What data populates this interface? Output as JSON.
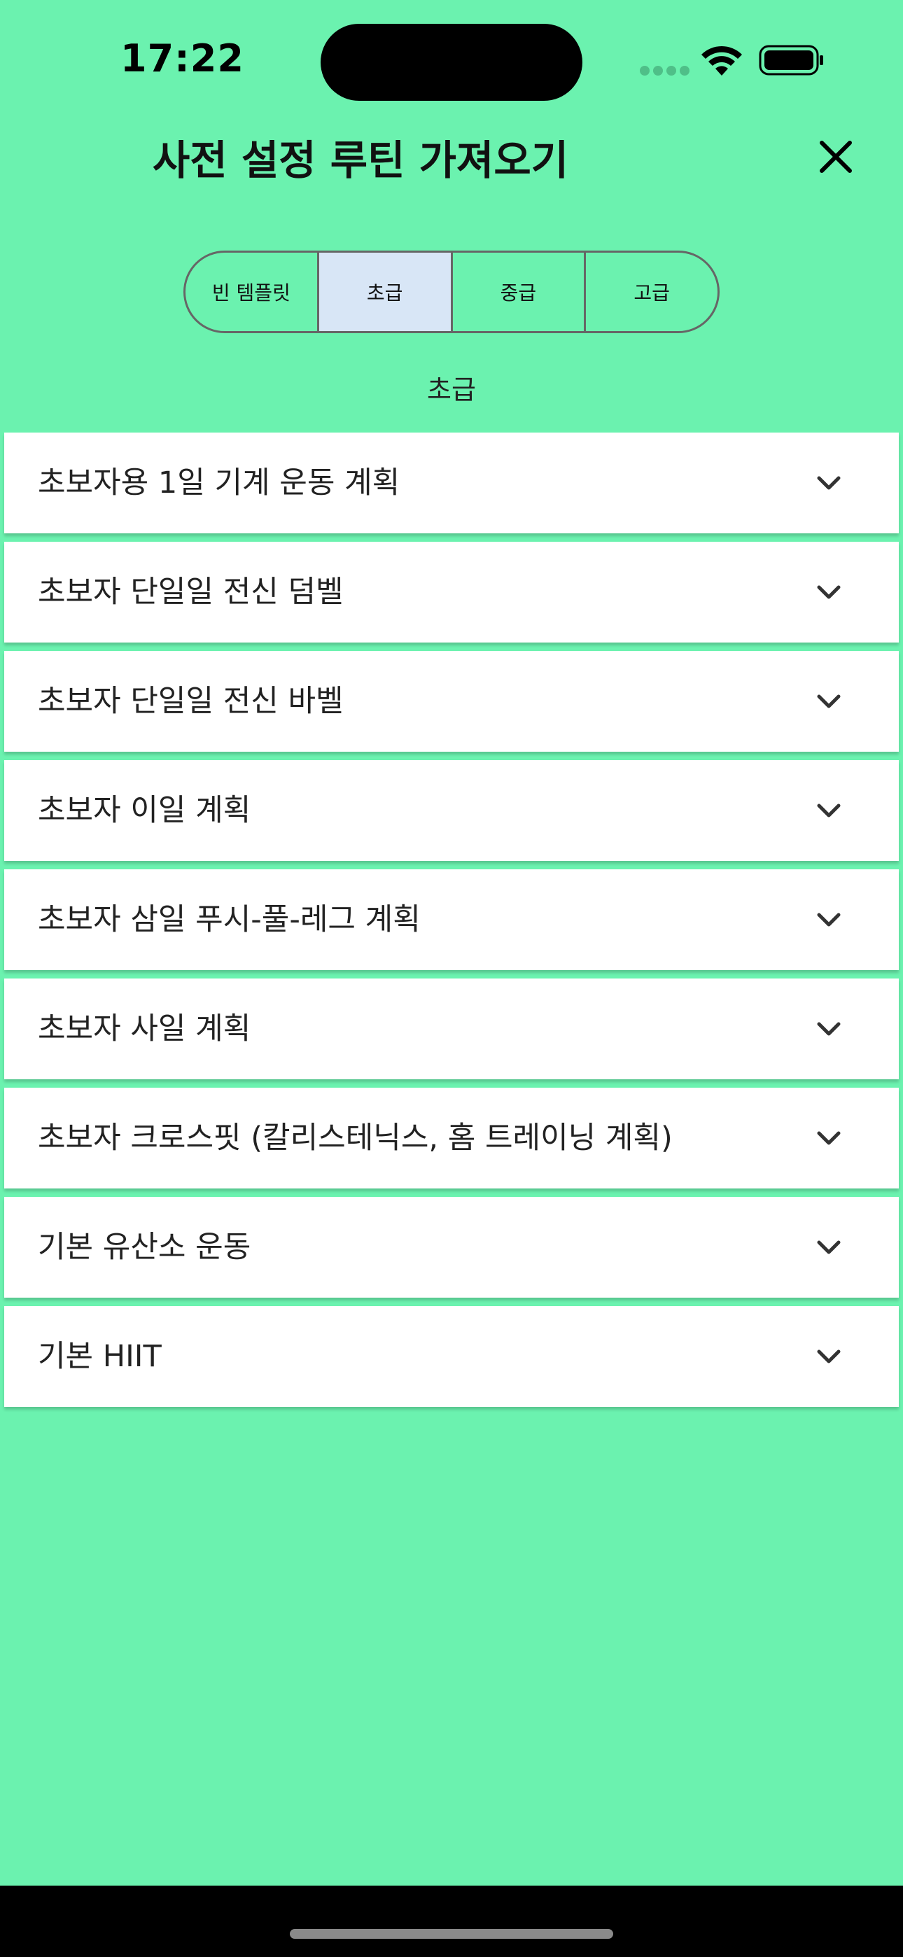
{
  "status_bar": {
    "time": "17:22",
    "icons": [
      "signal-dots-icon",
      "wifi-icon",
      "battery-icon"
    ]
  },
  "header": {
    "title": "사전 설정 루틴 가져오기",
    "close_icon": "close-icon"
  },
  "segments": {
    "items": [
      {
        "label": "빈 템플릿",
        "selected": false
      },
      {
        "label": "초급",
        "selected": true
      },
      {
        "label": "중급",
        "selected": false
      },
      {
        "label": "고급",
        "selected": false
      }
    ]
  },
  "section_label": "초급",
  "routines": [
    {
      "name": "초보자용 1일 기계 운동 계획"
    },
    {
      "name": "초보자 단일일 전신 덤벨"
    },
    {
      "name": "초보자 단일일 전신 바벨"
    },
    {
      "name": "초보자 이일 계획"
    },
    {
      "name": "초보자 삼일 푸시-풀-레그 계획"
    },
    {
      "name": "초보자 사일 계획"
    },
    {
      "name": "초보자 크로스핏 (칼리스테닉스, 홈 트레이닝 계획)"
    },
    {
      "name": "기본 유산소 운동"
    },
    {
      "name": "기본 HIIT"
    }
  ],
  "colors": {
    "background": "#6BF2AF",
    "selected_segment": "#D8E6F6",
    "card": "#FFFFFF"
  }
}
